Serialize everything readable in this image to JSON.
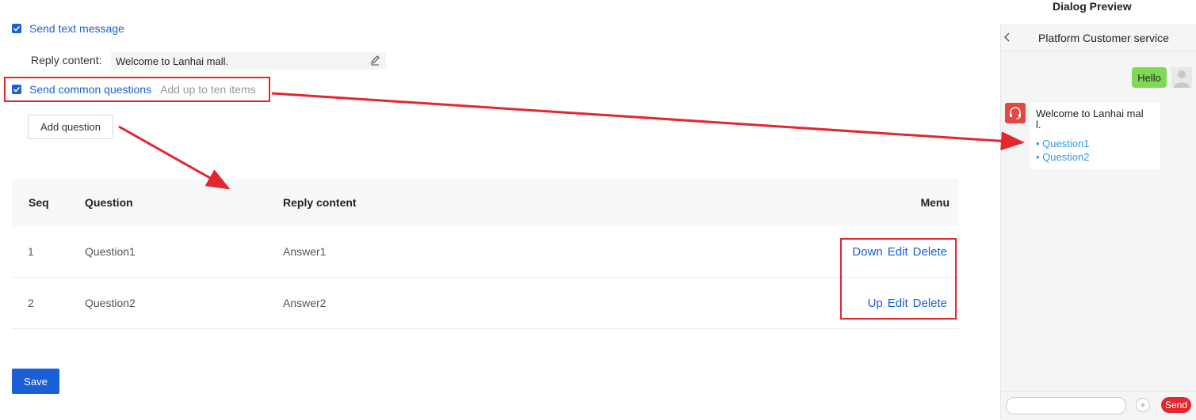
{
  "form": {
    "send_text": {
      "label": "Send text message",
      "checked": true
    },
    "reply_label": "Reply content:",
    "reply_value": "Welcome to Lanhai mall.",
    "send_questions": {
      "label": "Send common questions",
      "hint": "Add up to ten items",
      "checked": true
    },
    "add_question_label": "Add question",
    "save_label": "Save"
  },
  "table": {
    "headers": {
      "seq": "Seq",
      "question": "Question",
      "reply": "Reply content",
      "menu": "Menu"
    },
    "rows": [
      {
        "seq": "1",
        "question": "Question1",
        "reply": "Answer1",
        "actions": [
          "Down",
          "Edit",
          "Delete"
        ]
      },
      {
        "seq": "2",
        "question": "Question2",
        "reply": "Answer2",
        "actions": [
          "Up",
          "Edit",
          "Delete"
        ]
      }
    ]
  },
  "preview": {
    "title": "Dialog Preview",
    "header": "Platform Customer service",
    "user_message": "Hello",
    "bot_message_line1": "Welcome to Lanhai mal",
    "bot_message_line2": "l.",
    "questions": [
      "Question1",
      "Question2"
    ],
    "send_label": "Send",
    "plus_symbol": "+"
  },
  "colors": {
    "accent": "#1a5fd6",
    "annotation": "#e3262f",
    "user_bubble": "#7ed957",
    "send_button": "#e3262f"
  }
}
